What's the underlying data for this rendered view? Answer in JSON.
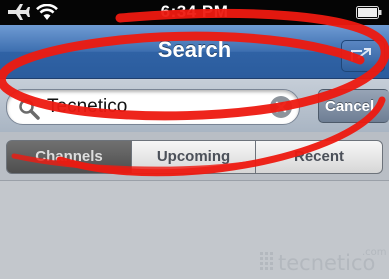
{
  "status_bar": {
    "time": "6:34 PM",
    "icons": [
      "airplane-icon",
      "wifi-icon",
      "battery-icon"
    ]
  },
  "nav_bar": {
    "title": "Search",
    "right_button_icon": "action-icon"
  },
  "search_bar": {
    "query": "Tecnetico",
    "cancel_label": "Cancel",
    "icons": [
      "magnifier-icon",
      "clear-icon"
    ]
  },
  "segments": {
    "items": [
      {
        "label": "Channels",
        "selected": true
      },
      {
        "label": "Upcoming",
        "selected": false
      },
      {
        "label": "Recent",
        "selected": false
      }
    ]
  },
  "watermark": {
    "text": "tecnetico",
    "suffix": ".com"
  },
  "colors": {
    "nav_blue": "#2f62a5",
    "annotation_red": "#ee1a10",
    "selected_segment": "#5a5a5a"
  }
}
